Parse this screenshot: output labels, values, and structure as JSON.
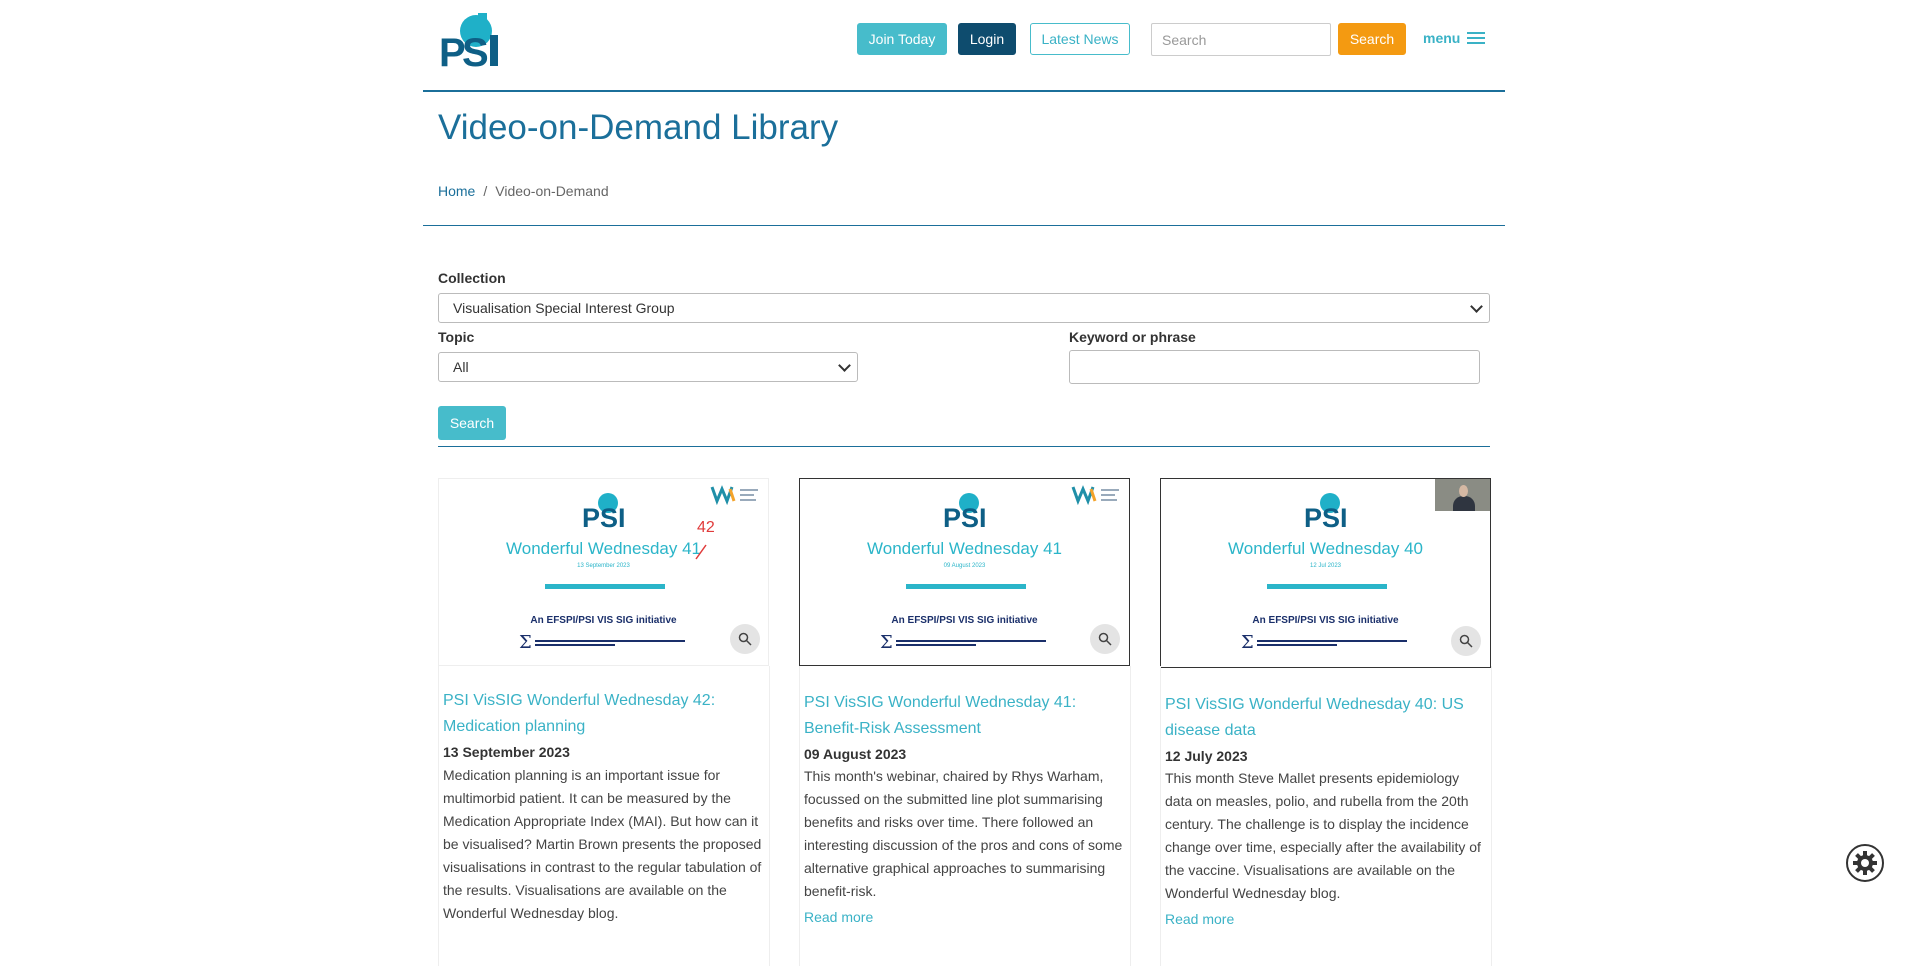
{
  "header": {
    "logo_text": "PSI",
    "join_label": "Join Today",
    "login_label": "Login",
    "news_label": "Latest News",
    "search_placeholder": "Search",
    "search_label": "Search",
    "menu_label": "menu"
  },
  "page": {
    "title": "Video-on-Demand Library",
    "breadcrumb": {
      "home": "Home",
      "separator": "/",
      "current": "Video-on-Demand"
    }
  },
  "filters": {
    "collection_label": "Collection",
    "collection_value": "Visualisation Special Interest Group",
    "topic_label": "Topic",
    "topic_value": "All",
    "keyword_label": "Keyword or phrase",
    "keyword_value": "",
    "search_label": "Search"
  },
  "cards": [
    {
      "thumb_title": "Wonderful Wednesday 41",
      "thumb_correction": "42",
      "thumb_date": "13 September 2023",
      "thumb_sub": "An EFSPI/PSI VIS SIG initiative",
      "title": "PSI VisSIG Wonderful Wednesday 42: Medication planning",
      "date": "13 September 2023",
      "description": "Medication planning is an important issue for multimorbid patient. It can be measured by the Medication Appropriate Index (MAI). But how can it be visualised? Martin Brown presents the proposed visualisations in contrast to the regular tabulation of the results. Visualisations are available on the Wonderful Wednesday blog.",
      "more": ""
    },
    {
      "thumb_title": "Wonderful Wednesday 41",
      "thumb_date": "09 August 2023",
      "thumb_sub": "An EFSPI/PSI VIS SIG initiative",
      "title": "PSI VisSIG Wonderful Wednesday 41: Benefit-Risk Assessment",
      "date": "09 August 2023",
      "description": "This month's webinar, chaired by Rhys Warham, focussed on the submitted line plot summarising benefits and risks over time. There followed an interesting discussion of the pros and cons of some alternative graphical approaches to summarising benefit-risk.",
      "more": "Read more"
    },
    {
      "thumb_title": "Wonderful Wednesday 40",
      "thumb_date": "12 Jul 2023",
      "thumb_sub": "An EFSPI/PSI VIS SIG initiative",
      "title": "PSI VisSIG Wonderful Wednesday 40: US disease data",
      "date": "12 July 2023",
      "description": "This month Steve Mallet presents epidemiology data on measles, polio, and rubella from the 20th century. The challenge is to display the incidence change over time, especially after the availability of the vaccine. Visualisations are available on the Wonderful Wednesday blog.",
      "more": "Read more"
    }
  ],
  "colors": {
    "brand_dark": "#1b6f9a",
    "teal": "#47bccb",
    "navy": "#0e4c6e",
    "orange": "#f49a11"
  }
}
